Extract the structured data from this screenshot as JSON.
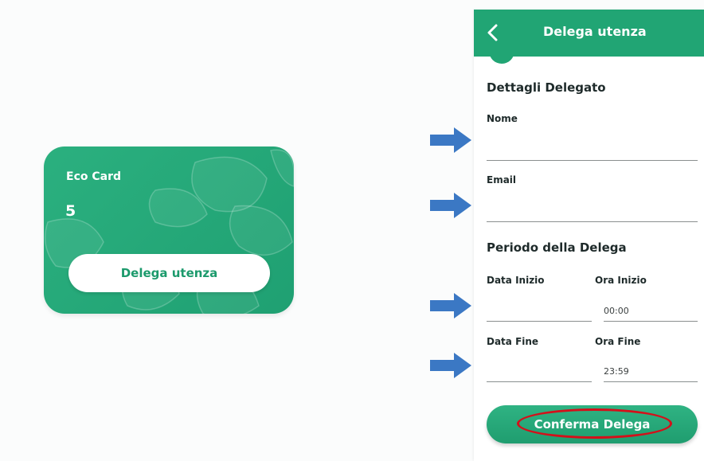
{
  "card": {
    "title": "Eco Card",
    "count": "5",
    "button_label": "Delega utenza"
  },
  "panel": {
    "header_title": "Delega utenza",
    "section_delegate": "Dettagli Delegato",
    "nome_label": "Nome",
    "nome_value": "",
    "email_label": "Email",
    "email_value": "",
    "section_period": "Periodo della Delega",
    "data_inizio_label": "Data Inizio",
    "data_inizio_value": "",
    "ora_inizio_label": "Ora Inizio",
    "ora_inizio_value": "00:00",
    "data_fine_label": "Data Fine",
    "data_fine_value": "",
    "ora_fine_label": "Ora Fine",
    "ora_fine_value": "23:59",
    "confirm_label": "Conferma Delega"
  },
  "colors": {
    "brand_green": "#21a574",
    "arrow_blue": "#3b78c4",
    "highlight_red": "#d4101a"
  },
  "icons": {
    "back": "chevron-left-icon",
    "pointer": "arrow-right-icon"
  }
}
